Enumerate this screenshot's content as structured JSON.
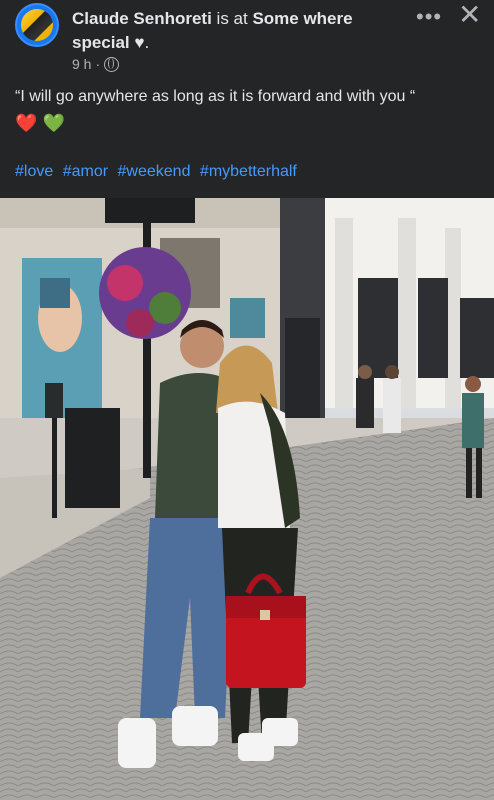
{
  "post": {
    "author": "Claude Senhoreti",
    "connector": " is at ",
    "place": "Some where special",
    "place_emoji": "♥",
    "period": ".",
    "time": "9 h",
    "separator": "·",
    "privacy_icon": "globe-icon",
    "more_label": "•••",
    "close_label": "✕",
    "caption": "“I will go anywhere as long as it is forward and with you “",
    "emojis": [
      "❤️",
      "💚"
    ],
    "hashtags": [
      "#love",
      "#amor",
      "#weekend",
      "#mybetterhalf"
    ]
  },
  "colors": {
    "background": "#242526",
    "text": "#e4e6eb",
    "secondary": "#b0b3b8",
    "hashtag": "#4599ff"
  },
  "photo": {
    "subject": "couple posing on cobblestone shopping street with red handbag"
  }
}
